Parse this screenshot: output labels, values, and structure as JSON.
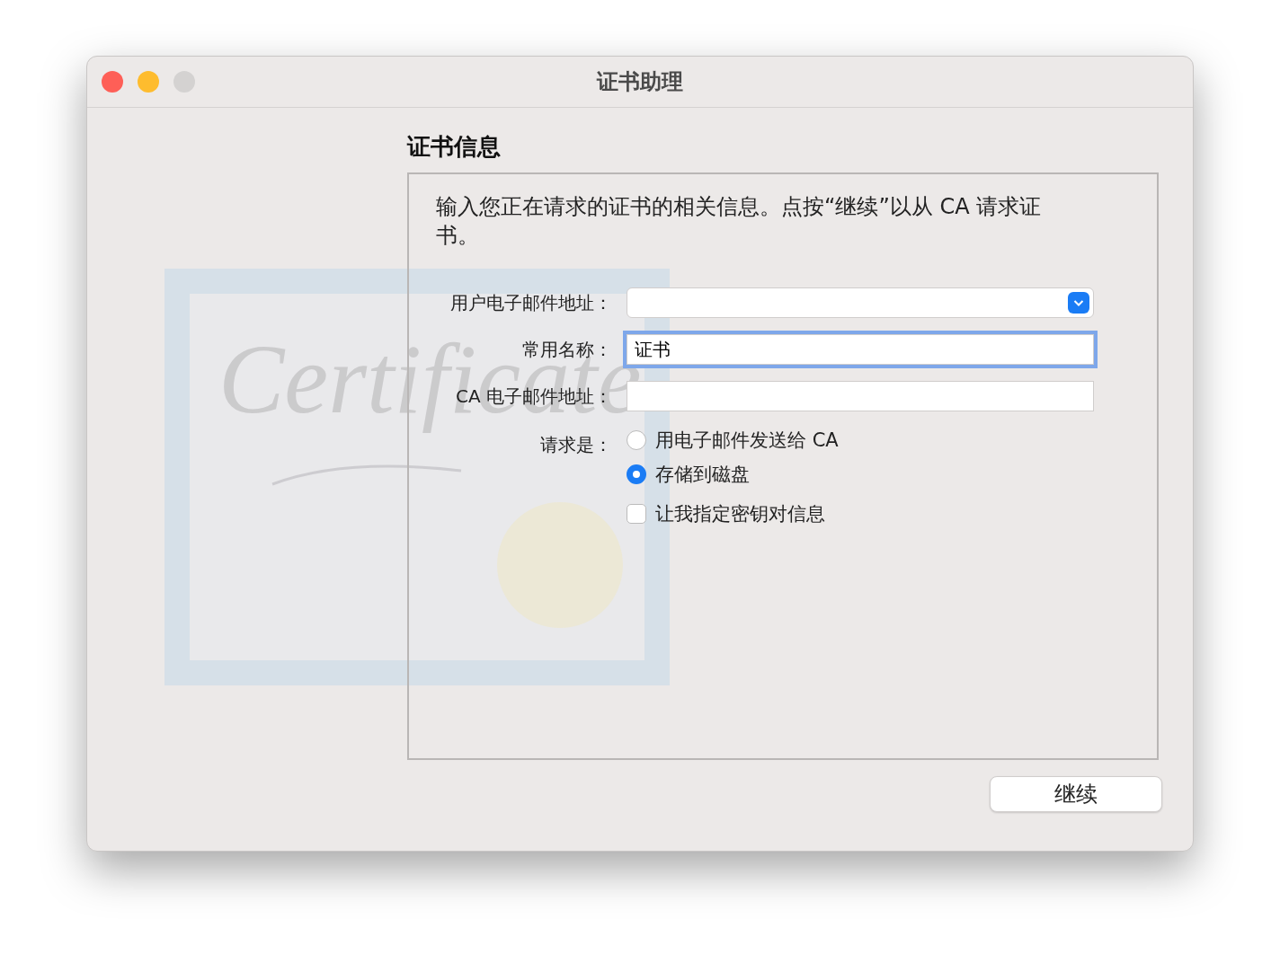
{
  "window": {
    "title": "证书助理",
    "controls": [
      {
        "kind": "close",
        "disabled": false
      },
      {
        "kind": "minimize",
        "disabled": false
      },
      {
        "kind": "zoom",
        "disabled": true
      }
    ]
  },
  "section_title": "证书信息",
  "certificate_art": {
    "title": "Certificate"
  },
  "intro": "输入您正在请求的证书的相关信息。点按“继续”以从 CA 请求证书。",
  "fields": [
    {
      "kind": "dropdown",
      "label": "用户电子邮件地址：",
      "focused": false
    },
    {
      "kind": "text",
      "label": "常用名称：",
      "value": "证书",
      "focused": true
    },
    {
      "kind": "text",
      "label": "CA 电子邮件地址：",
      "focused": false
    }
  ],
  "request": {
    "label": "请求是：",
    "options": [
      {
        "label": "用电子邮件发送给 CA",
        "selected": false
      },
      {
        "label": "存储到磁盘",
        "selected": true
      }
    ]
  },
  "checkbox": {
    "label": "让我指定密钥对信息",
    "checked": false
  },
  "buttons": [
    {
      "label": "继续"
    }
  ]
}
